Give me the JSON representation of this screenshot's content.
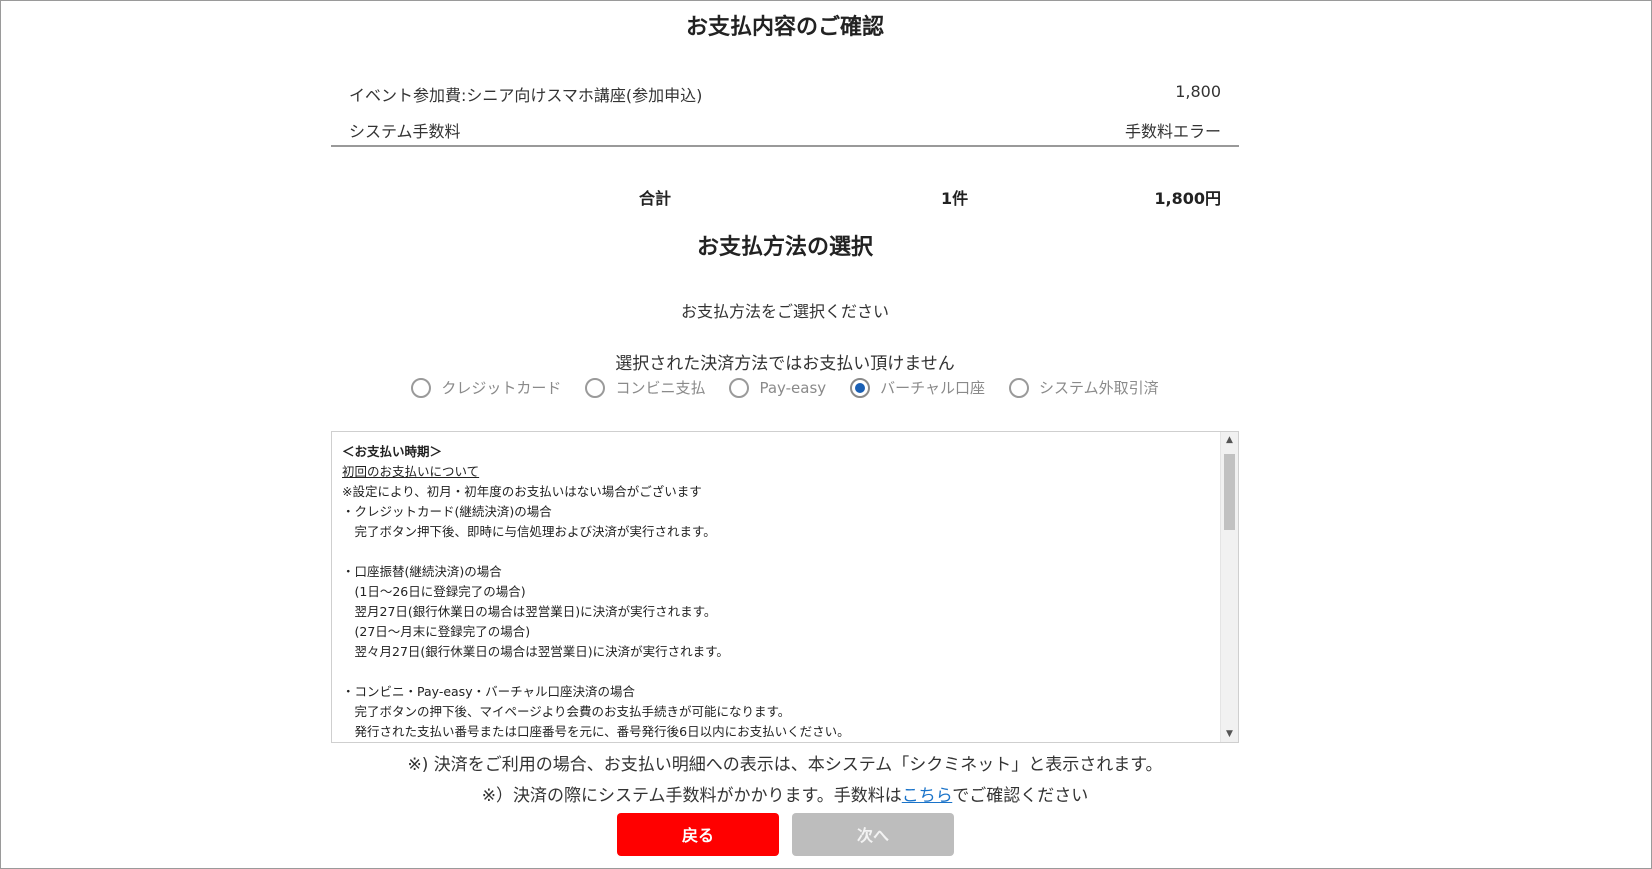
{
  "confirmation": {
    "title": "お支払内容のご確認",
    "items": [
      {
        "label": "イベント参加費:シニア向けスマホ講座(参加申込)",
        "value": "1,800"
      },
      {
        "label": "システム手数料",
        "value": "手数料エラー"
      }
    ],
    "total": {
      "label": "合計",
      "count": "1件",
      "amount": "1,800円"
    }
  },
  "payment": {
    "title": "お支払方法の選択",
    "prompt": "お支払方法をご選択ください",
    "unavailable": "選択された決済方法ではお支払い頂けません",
    "methods": [
      {
        "label": "クレジットカード",
        "selected": false
      },
      {
        "label": "コンビニ支払",
        "selected": false
      },
      {
        "label": "Pay-easy",
        "selected": false
      },
      {
        "label": "バーチャル口座",
        "selected": true
      },
      {
        "label": "システム外取引済",
        "selected": false
      }
    ],
    "selected_color": "#1a5fb4"
  },
  "notice": {
    "lines": [
      "＜お支払い時期＞",
      "初回のお支払いについて",
      "※設定により、初月・初年度のお支払いはない場合がございます",
      "・クレジットカード(継続決済)の場合",
      "　完了ボタン押下後、即時に与信処理および決済が実行されます。",
      "",
      "・口座振替(継続決済)の場合",
      "　(1日～26日に登録完了の場合)",
      "　翌月27日(銀行休業日の場合は翌営業日)に決済が実行されます。",
      "　(27日～月末に登録完了の場合)",
      "　翌々月27日(銀行休業日の場合は翌営業日)に決済が実行されます。",
      "",
      "・コンビニ・Pay-easy・バーチャル口座決済の場合",
      "　完了ボタンの押下後、マイページより会費のお支払手続きが可能になります。",
      "　発行された支払い番号または口座番号を元に、番号発行後6日以内にお支払いください。"
    ]
  },
  "footnotes": {
    "note1": "※) 決済をご利用の場合、お支払い明細への表示は、本システム「シクミネット」と表示されます。",
    "note2_prefix": "※）決済の際にシステム手数料がかかります。手数料は",
    "note2_link": "こちら",
    "note2_suffix": "でご確認ください"
  },
  "buttons": {
    "back": "戻る",
    "next": "次へ",
    "back_color": "#ff0000",
    "next_color": "#bdbdbd"
  }
}
